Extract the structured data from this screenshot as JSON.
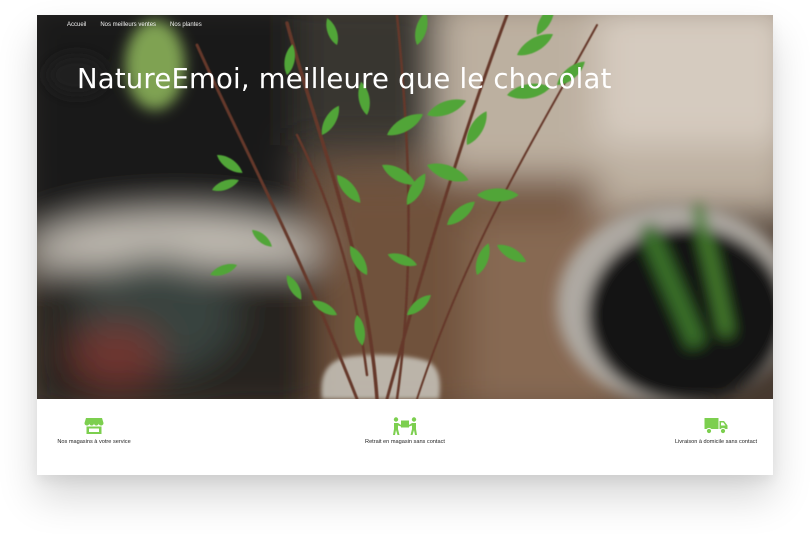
{
  "nav": {
    "items": [
      "Accueil",
      "Nos meilleurs ventes",
      "Nos plantes"
    ]
  },
  "hero": {
    "title": "NatureEmoi, meilleure que le chocolat"
  },
  "features": [
    {
      "icon": "store-icon",
      "label": "Nos magasins à votre service"
    },
    {
      "icon": "people-carry-icon",
      "label": "Retrait en magasin sans contact"
    },
    {
      "icon": "truck-icon",
      "label": "Livraison à domicile sans contact"
    }
  ],
  "colors": {
    "accent_green": "#7ccf4f",
    "text_dark": "#222222"
  }
}
